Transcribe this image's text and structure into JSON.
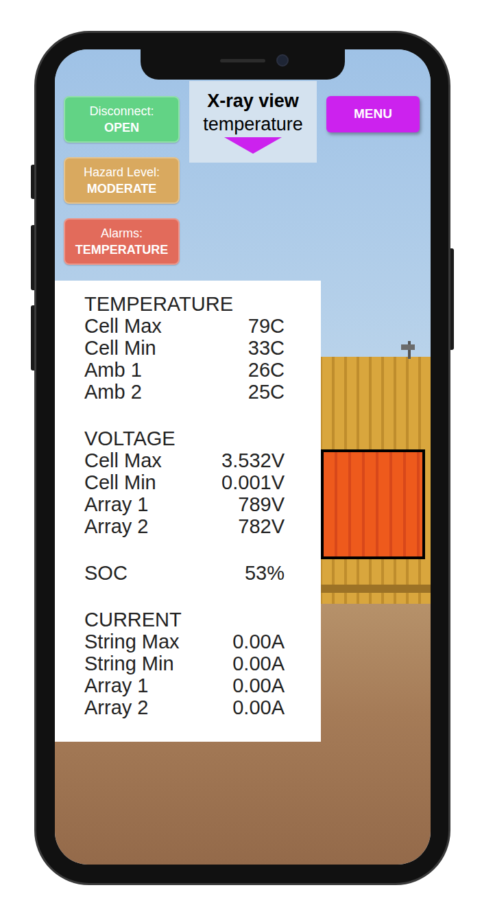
{
  "status_buttons": [
    {
      "label": "Disconnect:",
      "value": "OPEN",
      "color": "#62d385"
    },
    {
      "label": "Hazard Level:",
      "value": "MODERATE",
      "color": "#d9a95f"
    },
    {
      "label": "Alarms:",
      "value": "TEMPERATURE",
      "color": "#e26b5b"
    }
  ],
  "view_selector": {
    "title": "X-ray view",
    "mode": "temperature"
  },
  "menu_button": "MENU",
  "readings": [
    {
      "title": "TEMPERATURE",
      "rows": [
        {
          "label": "Cell Max",
          "value": "79C"
        },
        {
          "label": "Cell Min",
          "value": "33C"
        },
        {
          "label": "Amb 1",
          "value": "26C"
        },
        {
          "label": "Amb 2",
          "value": "25C"
        }
      ]
    },
    {
      "title": "VOLTAGE",
      "rows": [
        {
          "label": "Cell Max",
          "value": "3.532V"
        },
        {
          "label": "Cell Min",
          "value": "0.001V"
        },
        {
          "label": "Array 1",
          "value": "789V"
        },
        {
          "label": "Array 2",
          "value": "782V"
        }
      ]
    },
    {
      "rows": [
        {
          "label": "SOC",
          "value": "53%"
        }
      ]
    },
    {
      "title": "CURRENT",
      "rows": [
        {
          "label": "String Max",
          "value": "0.00A"
        },
        {
          "label": "String Min",
          "value": "0.00A"
        },
        {
          "label": "Array 1",
          "value": "0.00A"
        },
        {
          "label": "Array 2",
          "value": "0.00A"
        }
      ]
    }
  ]
}
